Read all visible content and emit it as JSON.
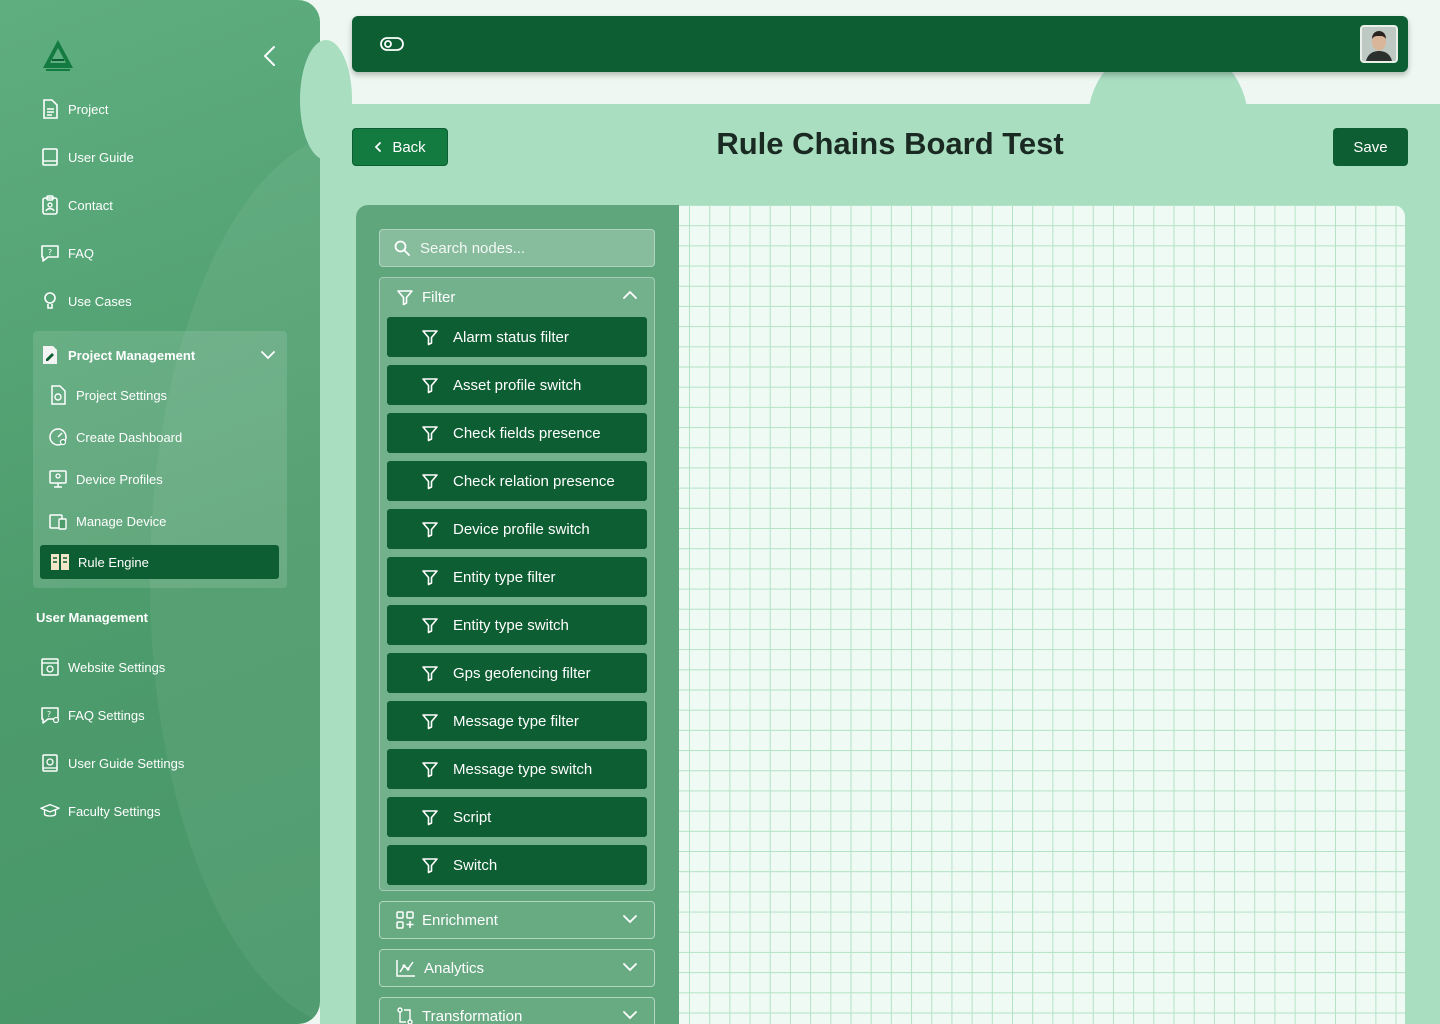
{
  "sidebar": {
    "nav": [
      {
        "label": "Project",
        "icon": "document-icon"
      },
      {
        "label": "User Guide",
        "icon": "book-icon"
      },
      {
        "label": "Contact",
        "icon": "contact-badge-icon"
      },
      {
        "label": "FAQ",
        "icon": "faq-bubble-icon"
      },
      {
        "label": "Use Cases",
        "icon": "lightbulb-icon"
      }
    ],
    "project_management": {
      "label": "Project Management",
      "items": [
        {
          "label": "Project Settings",
          "icon": "settings-document-icon"
        },
        {
          "label": "Create Dashboard",
          "icon": "dashboard-gauge-icon"
        },
        {
          "label": "Device Profiles",
          "icon": "monitor-profile-icon"
        },
        {
          "label": "Manage Device",
          "icon": "devices-icon"
        },
        {
          "label": "Rule Engine",
          "icon": "rule-engine-icon",
          "active": true
        }
      ]
    },
    "user_management_label": "User Management",
    "user_management": [
      {
        "label": "Website Settings",
        "icon": "website-settings-icon"
      },
      {
        "label": "FAQ Settings",
        "icon": "faq-settings-icon"
      },
      {
        "label": "User Guide Settings",
        "icon": "guide-settings-icon"
      },
      {
        "label": "Faculty Settings",
        "icon": "graduation-cap-icon"
      }
    ]
  },
  "header": {
    "back_label": "Back",
    "title": "Rule Chains Board Test",
    "save_label": "Save"
  },
  "palette": {
    "search_placeholder": "Search nodes...",
    "filter_group": {
      "label": "Filter",
      "expanded": true,
      "nodes": [
        "Alarm status filter",
        "Asset profile switch",
        "Check fields presence",
        "Check relation presence",
        "Device profile switch",
        "Entity type filter",
        "Entity type switch",
        "Gps geofencing filter",
        "Message type filter",
        "Message type switch",
        "Script",
        "Switch"
      ]
    },
    "collapsed_groups": [
      {
        "label": "Enrichment",
        "icon": "grid-plus-icon"
      },
      {
        "label": "Analytics",
        "icon": "analytics-chart-icon"
      },
      {
        "label": "Transformation",
        "icon": "transform-arrows-icon"
      }
    ]
  },
  "colors": {
    "primary_dark": "#0e5e33",
    "sidebar_green": "#4d9c6c",
    "panel_mint": "#a9dec0",
    "canvas_grid": "#b3e2c6"
  }
}
